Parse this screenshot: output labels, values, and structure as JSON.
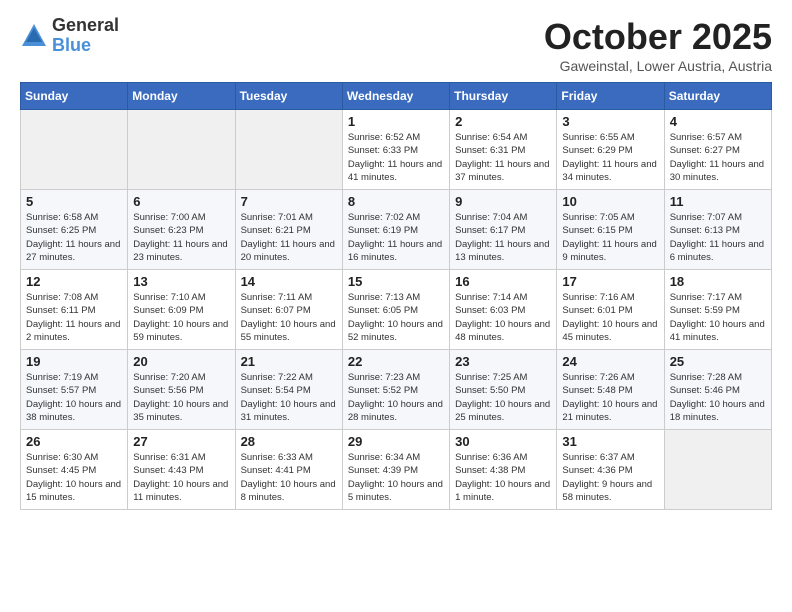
{
  "logo": {
    "general": "General",
    "blue": "Blue"
  },
  "header": {
    "title": "October 2025",
    "subtitle": "Gaweinstal, Lower Austria, Austria"
  },
  "weekdays": [
    "Sunday",
    "Monday",
    "Tuesday",
    "Wednesday",
    "Thursday",
    "Friday",
    "Saturday"
  ],
  "weeks": [
    [
      {
        "day": "",
        "sunrise": "",
        "sunset": "",
        "daylight": ""
      },
      {
        "day": "",
        "sunrise": "",
        "sunset": "",
        "daylight": ""
      },
      {
        "day": "",
        "sunrise": "",
        "sunset": "",
        "daylight": ""
      },
      {
        "day": "1",
        "sunrise": "Sunrise: 6:52 AM",
        "sunset": "Sunset: 6:33 PM",
        "daylight": "Daylight: 11 hours and 41 minutes."
      },
      {
        "day": "2",
        "sunrise": "Sunrise: 6:54 AM",
        "sunset": "Sunset: 6:31 PM",
        "daylight": "Daylight: 11 hours and 37 minutes."
      },
      {
        "day": "3",
        "sunrise": "Sunrise: 6:55 AM",
        "sunset": "Sunset: 6:29 PM",
        "daylight": "Daylight: 11 hours and 34 minutes."
      },
      {
        "day": "4",
        "sunrise": "Sunrise: 6:57 AM",
        "sunset": "Sunset: 6:27 PM",
        "daylight": "Daylight: 11 hours and 30 minutes."
      }
    ],
    [
      {
        "day": "5",
        "sunrise": "Sunrise: 6:58 AM",
        "sunset": "Sunset: 6:25 PM",
        "daylight": "Daylight: 11 hours and 27 minutes."
      },
      {
        "day": "6",
        "sunrise": "Sunrise: 7:00 AM",
        "sunset": "Sunset: 6:23 PM",
        "daylight": "Daylight: 11 hours and 23 minutes."
      },
      {
        "day": "7",
        "sunrise": "Sunrise: 7:01 AM",
        "sunset": "Sunset: 6:21 PM",
        "daylight": "Daylight: 11 hours and 20 minutes."
      },
      {
        "day": "8",
        "sunrise": "Sunrise: 7:02 AM",
        "sunset": "Sunset: 6:19 PM",
        "daylight": "Daylight: 11 hours and 16 minutes."
      },
      {
        "day": "9",
        "sunrise": "Sunrise: 7:04 AM",
        "sunset": "Sunset: 6:17 PM",
        "daylight": "Daylight: 11 hours and 13 minutes."
      },
      {
        "day": "10",
        "sunrise": "Sunrise: 7:05 AM",
        "sunset": "Sunset: 6:15 PM",
        "daylight": "Daylight: 11 hours and 9 minutes."
      },
      {
        "day": "11",
        "sunrise": "Sunrise: 7:07 AM",
        "sunset": "Sunset: 6:13 PM",
        "daylight": "Daylight: 11 hours and 6 minutes."
      }
    ],
    [
      {
        "day": "12",
        "sunrise": "Sunrise: 7:08 AM",
        "sunset": "Sunset: 6:11 PM",
        "daylight": "Daylight: 11 hours and 2 minutes."
      },
      {
        "day": "13",
        "sunrise": "Sunrise: 7:10 AM",
        "sunset": "Sunset: 6:09 PM",
        "daylight": "Daylight: 10 hours and 59 minutes."
      },
      {
        "day": "14",
        "sunrise": "Sunrise: 7:11 AM",
        "sunset": "Sunset: 6:07 PM",
        "daylight": "Daylight: 10 hours and 55 minutes."
      },
      {
        "day": "15",
        "sunrise": "Sunrise: 7:13 AM",
        "sunset": "Sunset: 6:05 PM",
        "daylight": "Daylight: 10 hours and 52 minutes."
      },
      {
        "day": "16",
        "sunrise": "Sunrise: 7:14 AM",
        "sunset": "Sunset: 6:03 PM",
        "daylight": "Daylight: 10 hours and 48 minutes."
      },
      {
        "day": "17",
        "sunrise": "Sunrise: 7:16 AM",
        "sunset": "Sunset: 6:01 PM",
        "daylight": "Daylight: 10 hours and 45 minutes."
      },
      {
        "day": "18",
        "sunrise": "Sunrise: 7:17 AM",
        "sunset": "Sunset: 5:59 PM",
        "daylight": "Daylight: 10 hours and 41 minutes."
      }
    ],
    [
      {
        "day": "19",
        "sunrise": "Sunrise: 7:19 AM",
        "sunset": "Sunset: 5:57 PM",
        "daylight": "Daylight: 10 hours and 38 minutes."
      },
      {
        "day": "20",
        "sunrise": "Sunrise: 7:20 AM",
        "sunset": "Sunset: 5:56 PM",
        "daylight": "Daylight: 10 hours and 35 minutes."
      },
      {
        "day": "21",
        "sunrise": "Sunrise: 7:22 AM",
        "sunset": "Sunset: 5:54 PM",
        "daylight": "Daylight: 10 hours and 31 minutes."
      },
      {
        "day": "22",
        "sunrise": "Sunrise: 7:23 AM",
        "sunset": "Sunset: 5:52 PM",
        "daylight": "Daylight: 10 hours and 28 minutes."
      },
      {
        "day": "23",
        "sunrise": "Sunrise: 7:25 AM",
        "sunset": "Sunset: 5:50 PM",
        "daylight": "Daylight: 10 hours and 25 minutes."
      },
      {
        "day": "24",
        "sunrise": "Sunrise: 7:26 AM",
        "sunset": "Sunset: 5:48 PM",
        "daylight": "Daylight: 10 hours and 21 minutes."
      },
      {
        "day": "25",
        "sunrise": "Sunrise: 7:28 AM",
        "sunset": "Sunset: 5:46 PM",
        "daylight": "Daylight: 10 hours and 18 minutes."
      }
    ],
    [
      {
        "day": "26",
        "sunrise": "Sunrise: 6:30 AM",
        "sunset": "Sunset: 4:45 PM",
        "daylight": "Daylight: 10 hours and 15 minutes."
      },
      {
        "day": "27",
        "sunrise": "Sunrise: 6:31 AM",
        "sunset": "Sunset: 4:43 PM",
        "daylight": "Daylight: 10 hours and 11 minutes."
      },
      {
        "day": "28",
        "sunrise": "Sunrise: 6:33 AM",
        "sunset": "Sunset: 4:41 PM",
        "daylight": "Daylight: 10 hours and 8 minutes."
      },
      {
        "day": "29",
        "sunrise": "Sunrise: 6:34 AM",
        "sunset": "Sunset: 4:39 PM",
        "daylight": "Daylight: 10 hours and 5 minutes."
      },
      {
        "day": "30",
        "sunrise": "Sunrise: 6:36 AM",
        "sunset": "Sunset: 4:38 PM",
        "daylight": "Daylight: 10 hours and 1 minute."
      },
      {
        "day": "31",
        "sunrise": "Sunrise: 6:37 AM",
        "sunset": "Sunset: 4:36 PM",
        "daylight": "Daylight: 9 hours and 58 minutes."
      },
      {
        "day": "",
        "sunrise": "",
        "sunset": "",
        "daylight": ""
      }
    ]
  ]
}
